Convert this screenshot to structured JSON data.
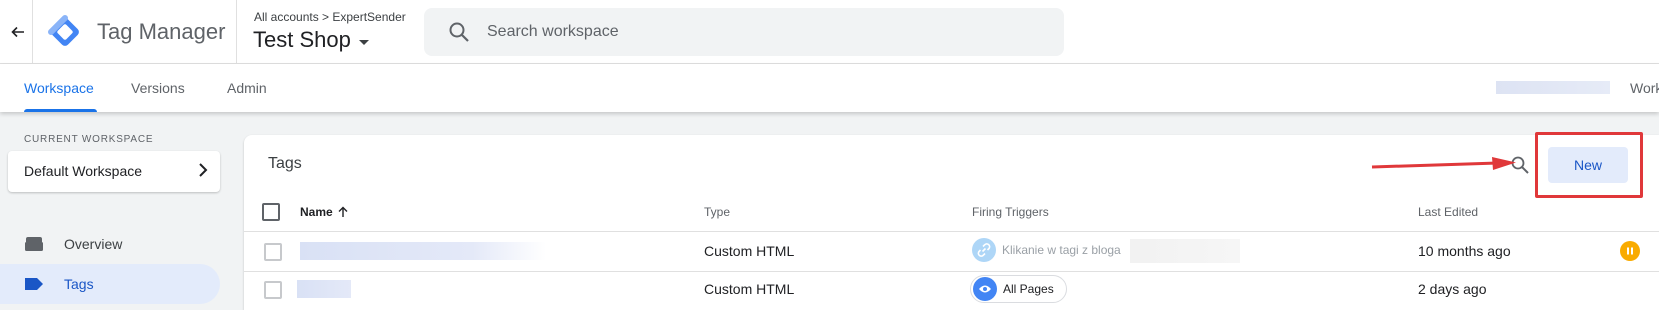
{
  "header": {
    "product": "Tag Manager",
    "breadcrumb": "All accounts > ExpertSender",
    "container": "Test Shop",
    "search_placeholder": "Search workspace"
  },
  "tabs": [
    {
      "label": "Workspace",
      "active": true
    },
    {
      "label": "Versions",
      "active": false
    },
    {
      "label": "Admin",
      "active": false
    }
  ],
  "tabs_right": "Work",
  "sidebar": {
    "current_workspace_label": "CURRENT WORKSPACE",
    "workspace_name": "Default Workspace",
    "items": [
      {
        "label": "Overview",
        "icon": "folder-icon",
        "active": false
      },
      {
        "label": "Tags",
        "icon": "tag-icon",
        "active": true
      }
    ]
  },
  "tags_panel": {
    "title": "Tags",
    "new_button": "New",
    "columns": [
      "Name",
      "Type",
      "Firing Triggers",
      "Last Edited"
    ],
    "rows": [
      {
        "type": "Custom HTML",
        "trigger": "Klikanie w tagi z bloga",
        "last_edited": "10 months ago",
        "status": "paused"
      },
      {
        "type": "Custom HTML",
        "trigger": "All Pages",
        "last_edited": "2 days ago",
        "status": ""
      }
    ]
  },
  "colors": {
    "accent": "#1a73e8",
    "highlight": "#e0383a",
    "paused": "#f9ab00"
  }
}
